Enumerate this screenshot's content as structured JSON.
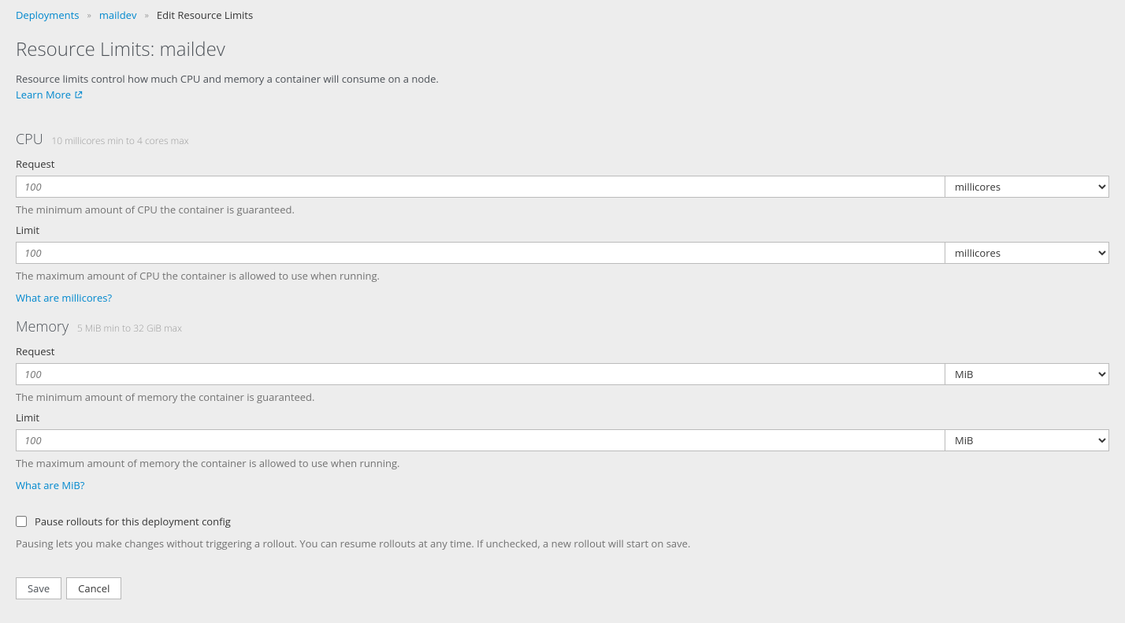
{
  "breadcrumb": {
    "items": [
      {
        "label": "Deployments"
      },
      {
        "label": "maildev"
      }
    ],
    "current": "Edit Resource Limits"
  },
  "page": {
    "title": "Resource Limits: maildev",
    "description": "Resource limits control how much CPU and memory a container will consume on a node.",
    "learn_more": "Learn More"
  },
  "cpu": {
    "title": "CPU",
    "hint": "10 millicores min to 4 cores max",
    "request": {
      "label": "Request",
      "placeholder": "100",
      "value": "",
      "unit": "millicores",
      "help": "The minimum amount of CPU the container is guaranteed."
    },
    "limit": {
      "label": "Limit",
      "placeholder": "100",
      "value": "",
      "unit": "millicores",
      "help": "The maximum amount of CPU the container is allowed to use when running."
    },
    "unit_help_link": "What are millicores?"
  },
  "memory": {
    "title": "Memory",
    "hint": "5 MiB min to 32 GiB max",
    "request": {
      "label": "Request",
      "placeholder": "100",
      "value": "",
      "unit": "MiB",
      "help": "The minimum amount of memory the container is guaranteed."
    },
    "limit": {
      "label": "Limit",
      "placeholder": "100",
      "value": "",
      "unit": "MiB",
      "help": "The maximum amount of memory the container is allowed to use when running."
    },
    "unit_help_link": "What are MiB?"
  },
  "pause": {
    "label": "Pause rollouts for this deployment config",
    "help": "Pausing lets you make changes without triggering a rollout. You can resume rollouts at any time. If unchecked, a new rollout will start on save."
  },
  "buttons": {
    "save": "Save",
    "cancel": "Cancel"
  }
}
